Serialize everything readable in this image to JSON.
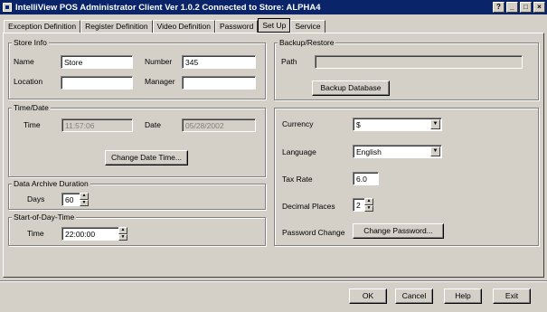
{
  "window": {
    "title": "IntelliView POS Administrator Client  Ver 1.0.2 Connected to Store: ALPHA4"
  },
  "tabs": [
    {
      "label": "Exception Definition"
    },
    {
      "label": "Register Definition"
    },
    {
      "label": "Video Definition"
    },
    {
      "label": "Password"
    },
    {
      "label": "Set Up",
      "active": true
    },
    {
      "label": "Service"
    }
  ],
  "store_info": {
    "legend": "Store Info",
    "name_label": "Name",
    "name_value": "Store",
    "number_label": "Number",
    "number_value": "345",
    "location_label": "Location",
    "location_value": "",
    "manager_label": "Manager",
    "manager_value": ""
  },
  "time_date": {
    "legend": "Time/Date",
    "time_label": "Time",
    "time_value": "11:57:06",
    "date_label": "Date",
    "date_value": "05/28/2002",
    "change_button": "Change Date Time..."
  },
  "archive": {
    "legend": "Data Archive Duration",
    "days_label": "Days",
    "days_value": "60"
  },
  "start_of_day": {
    "legend": "Start-of-Day-Time",
    "time_label": "Time",
    "time_value": "22:00:00"
  },
  "backup": {
    "legend": "Backup/Restore",
    "path_label": "Path",
    "path_value": "",
    "button": "Backup Database"
  },
  "settings": {
    "currency_label": "Currency",
    "currency_value": "$",
    "language_label": "Language",
    "language_value": "English",
    "tax_label": "Tax Rate",
    "tax_value": "6.0",
    "decimal_label": "Decimal Places",
    "decimal_value": "2",
    "password_label": "Password Change",
    "password_button": "Change Password..."
  },
  "footer": {
    "ok": "OK",
    "cancel": "Cancel",
    "help": "Help",
    "exit": "Exit"
  }
}
